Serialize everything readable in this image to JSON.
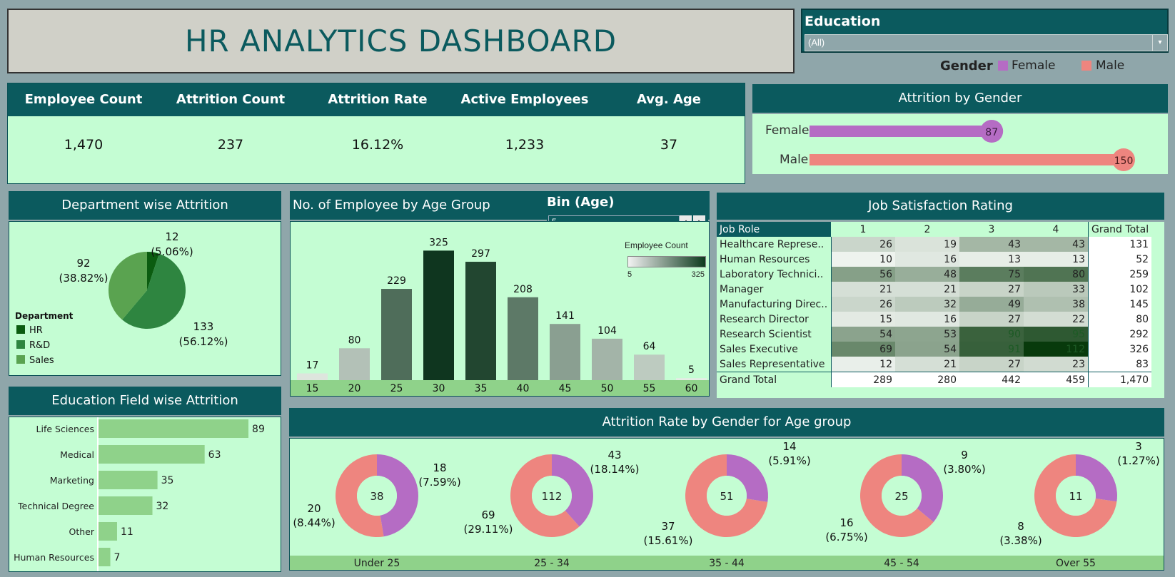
{
  "title": "HR ANALYTICS DASHBOARD",
  "education_filter": {
    "label": "Education",
    "value": "(All)"
  },
  "gender_legend": {
    "label": "Gender",
    "items": [
      {
        "name": "Female",
        "color": "#b56cc4"
      },
      {
        "name": "Male",
        "color": "#ee857f"
      }
    ]
  },
  "kpis": [
    {
      "label": "Employee Count",
      "value": "1,470"
    },
    {
      "label": "Attrition Count",
      "value": "237"
    },
    {
      "label": "Attrition Rate",
      "value": "16.12%"
    },
    {
      "label": "Active Employees",
      "value": "1,233"
    },
    {
      "label": "Avg. Age",
      "value": "37"
    }
  ],
  "attrition_gender": {
    "title": "Attrition by Gender",
    "rows": [
      {
        "label": "Female",
        "value": 87,
        "display": "87",
        "color": "#b56cc4"
      },
      {
        "label": "Male",
        "value": 150,
        "display": "150",
        "color": "#ee857f"
      }
    ]
  },
  "department": {
    "title": "Department  wise  Attrition",
    "legend_title": "Department",
    "slices": [
      {
        "name": "HR",
        "value": 12,
        "label": "12",
        "pct": "(5.06%)",
        "color": "#0b5c10"
      },
      {
        "name": "R&D",
        "value": 133,
        "label": "133",
        "pct": "(56.12%)",
        "color": "#2e8540"
      },
      {
        "name": "Sales",
        "value": 92,
        "label": "92",
        "pct": "(38.82%)",
        "color": "#5aa350"
      }
    ]
  },
  "age_group": {
    "title": "No. of Employee by Age Group",
    "bin_label": "Bin (Age)",
    "bin_value": "5",
    "legend_title": "Employee Count",
    "legend_min": "5",
    "legend_max": "325"
  },
  "job_satisfaction": {
    "title": "Job Satisfaction Rating",
    "col_header": "Job Role",
    "columns": [
      "1",
      "2",
      "3",
      "4"
    ],
    "grand_total_label": "Grand Total",
    "rows": [
      {
        "role": "Healthcare Represe..",
        "values": [
          26,
          19,
          43,
          43
        ],
        "total": "131"
      },
      {
        "role": "Human Resources",
        "values": [
          10,
          16,
          13,
          13
        ],
        "total": "52"
      },
      {
        "role": "Laboratory Technici..",
        "values": [
          56,
          48,
          75,
          80
        ],
        "total": "259"
      },
      {
        "role": "Manager",
        "values": [
          21,
          21,
          27,
          33
        ],
        "total": "102"
      },
      {
        "role": "Manufacturing Direc..",
        "values": [
          26,
          32,
          49,
          38
        ],
        "total": "145"
      },
      {
        "role": "Research Director",
        "values": [
          15,
          16,
          27,
          22
        ],
        "total": "80"
      },
      {
        "role": "Research Scientist",
        "values": [
          54,
          53,
          90,
          95
        ],
        "total": "292"
      },
      {
        "role": "Sales Executive",
        "values": [
          69,
          54,
          91,
          112
        ],
        "total": "326"
      },
      {
        "role": "Sales Representative",
        "values": [
          12,
          21,
          27,
          23
        ],
        "total": "83"
      }
    ],
    "totals_row": {
      "label": "Grand Total",
      "values": [
        "289",
        "280",
        "442",
        "459"
      ],
      "total": "1,470"
    }
  },
  "education_field": {
    "title": "Education Field wise Attrition"
  },
  "age_gender": {
    "title": "Attrition Rate by Gender for Age group",
    "groups": [
      {
        "label": "Under 25",
        "total": "38",
        "female": 18,
        "male": 20,
        "female_label": "18",
        "female_pct": "(7.59%)",
        "male_label": "20",
        "male_pct": "(8.44%)"
      },
      {
        "label": "25 - 34",
        "total": "112",
        "female": 43,
        "male": 69,
        "female_label": "43",
        "female_pct": "(18.14%)",
        "male_label": "69",
        "male_pct": "(29.11%)"
      },
      {
        "label": "35 - 44",
        "total": "51",
        "female": 14,
        "male": 37,
        "female_label": "14",
        "female_pct": "(5.91%)",
        "male_label": "37",
        "male_pct": "(15.61%)"
      },
      {
        "label": "45 - 54",
        "total": "25",
        "female": 9,
        "male": 16,
        "female_label": "9",
        "female_pct": "(3.80%)",
        "male_label": "16",
        "male_pct": "(6.75%)"
      },
      {
        "label": "Over 55",
        "total": "11",
        "female": 3,
        "male": 8,
        "female_label": "3",
        "female_pct": "(1.27%)",
        "male_label": "8",
        "male_pct": "(3.38%)"
      }
    ]
  },
  "chart_data": [
    {
      "type": "bar",
      "title": "No. of Employee by Age Group",
      "categories": [
        "15",
        "20",
        "25",
        "30",
        "35",
        "40",
        "45",
        "50",
        "55",
        "60"
      ],
      "values": [
        17,
        80,
        229,
        325,
        297,
        208,
        141,
        104,
        64,
        5
      ],
      "ylim": [
        0,
        340
      ]
    },
    {
      "type": "bar",
      "title": "Education Field wise Attrition",
      "orientation": "horizontal",
      "categories": [
        "Life Sciences",
        "Medical",
        "Marketing",
        "Technical Degree",
        "Other",
        "Human Resources"
      ],
      "values": [
        89,
        63,
        35,
        32,
        11,
        7
      ],
      "color": "#8fd28a"
    },
    {
      "type": "pie",
      "title": "Department  wise  Attrition",
      "categories": [
        "HR",
        "R&D",
        "Sales"
      ],
      "values": [
        12,
        133,
        92
      ]
    }
  ]
}
